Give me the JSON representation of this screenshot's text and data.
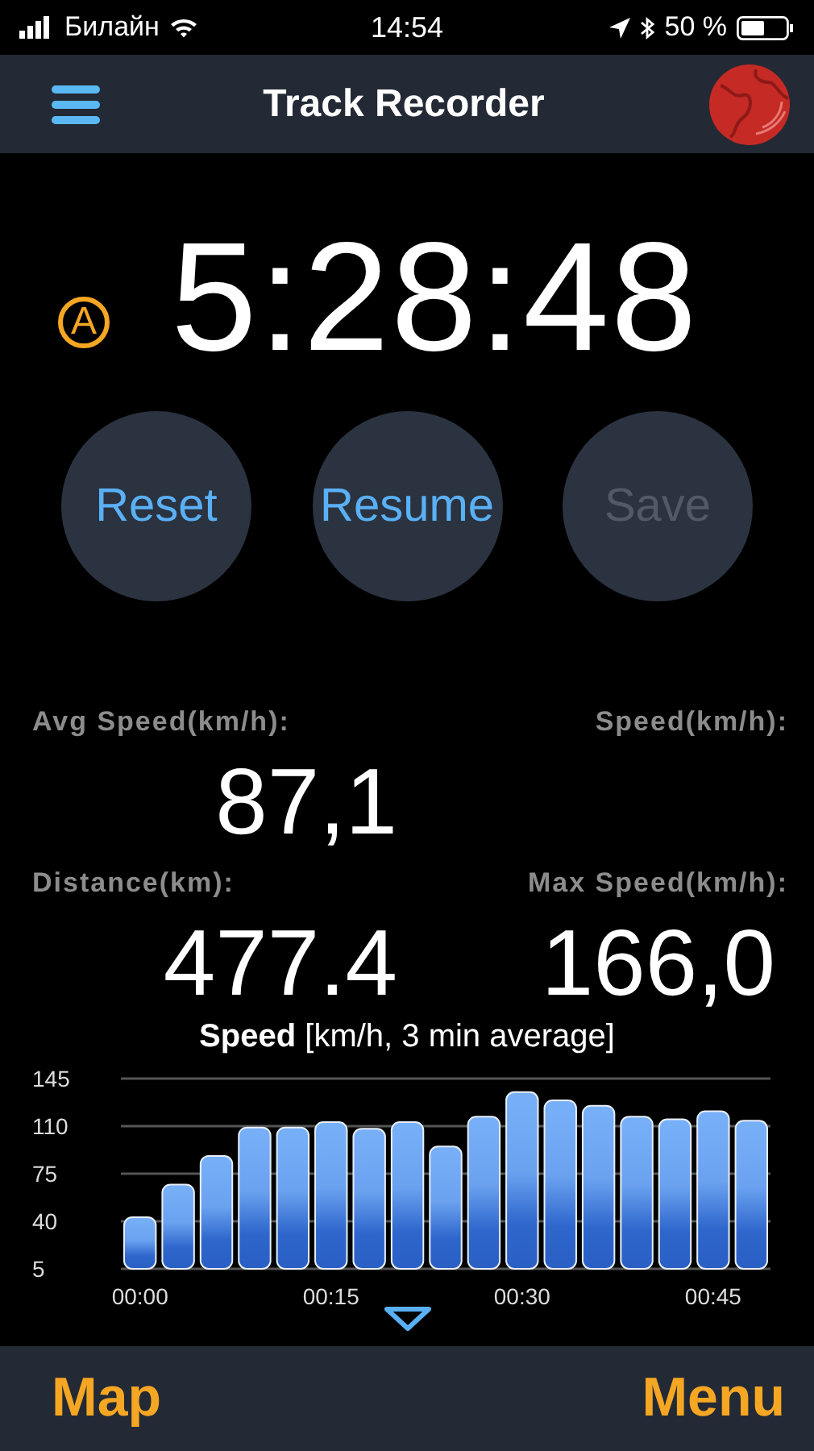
{
  "status_bar": {
    "carrier": "Билайн",
    "time": "14:54",
    "battery": "50 %"
  },
  "nav_bar": {
    "title": "Track Recorder"
  },
  "timer": {
    "badge": "A",
    "time": "5:28:48"
  },
  "buttons": [
    {
      "label": "Reset",
      "disabled": false
    },
    {
      "label": "Resume",
      "disabled": false
    },
    {
      "label": "Save",
      "disabled": true
    }
  ],
  "stats": [
    {
      "label": "Avg Speed(km/h):",
      "value": "87,1"
    },
    {
      "label": "Speed(km/h):"
    },
    {
      "label": "Distance(km):",
      "value": "477.4"
    },
    {
      "label": "Max Speed(km/h):",
      "value": "166,0"
    }
  ],
  "chart": {
    "title": "**Speed** [km/h, 3 min average]",
    "chart_data": {
      "type": "bar",
      "x": [
        0,
        3,
        6,
        9,
        12,
        15,
        18,
        21,
        24,
        27,
        30,
        33,
        36,
        39,
        42,
        45,
        48
      ],
      "values": [
        43,
        67,
        88,
        109,
        109,
        113,
        108,
        113,
        95,
        117,
        135,
        129,
        125,
        117,
        115,
        121,
        114
      ],
      "xlim": [
        -1.5,
        49.5
      ],
      "ylim": [
        5,
        145
      ],
      "grid": true,
      "yticks": [
        5,
        40,
        75,
        110,
        145
      ],
      "xticks": [
        {
          "value": 0,
          "label": "00:00"
        },
        {
          "value": 15,
          "label": "00:15"
        },
        {
          "value": 30,
          "label": "00:30"
        },
        {
          "value": 45,
          "label": "00:45"
        }
      ]
    }
  },
  "tab_bar": {
    "left": "Map",
    "right": "Menu"
  }
}
